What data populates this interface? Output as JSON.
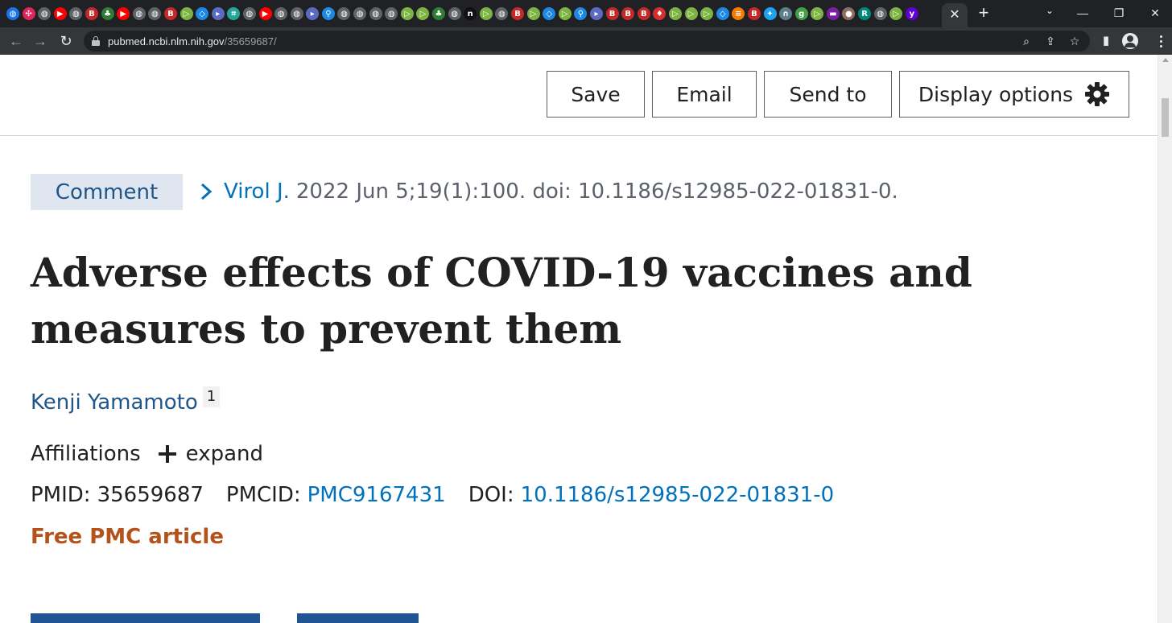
{
  "browser": {
    "active_tab_close": "✕",
    "new_tab": "+",
    "tab_search": "⌄",
    "window_controls": {
      "minimize": "—",
      "restore": "❐",
      "close": "✕"
    },
    "nav": {
      "back": "←",
      "forward": "→",
      "reload": "↻"
    },
    "url": {
      "host": "pubmed.ncbi.nlm.nih.gov",
      "path": "/35659687/"
    },
    "omnibox_icons": {
      "zoom": "⌕",
      "share": "⇪",
      "bookmark": "☆"
    },
    "side_panel_icon": "▮",
    "favicons": [
      {
        "name": "globe-icon",
        "glyph": "◍",
        "color": "#1a73e8"
      },
      {
        "name": "pin-icon",
        "glyph": "✣",
        "color": "#e0245e"
      },
      {
        "name": "globe-icon",
        "glyph": "◍",
        "color": "#5f6368"
      },
      {
        "name": "youtube-icon",
        "glyph": "▶",
        "color": "#ff0000"
      },
      {
        "name": "globe-icon",
        "glyph": "◍",
        "color": "#5f6368"
      },
      {
        "name": "bi-icon",
        "glyph": "B",
        "color": "#c62828"
      },
      {
        "name": "tree-icon",
        "glyph": "♣",
        "color": "#2e7d32"
      },
      {
        "name": "youtube-icon",
        "glyph": "▶",
        "color": "#ff0000"
      },
      {
        "name": "globe-icon",
        "glyph": "◍",
        "color": "#5f6368"
      },
      {
        "name": "globe-icon",
        "glyph": "◍",
        "color": "#5f6368"
      },
      {
        "name": "bi-icon",
        "glyph": "B",
        "color": "#c62828"
      },
      {
        "name": "play-icon",
        "glyph": "▷",
        "color": "#7cb342"
      },
      {
        "name": "shield-icon",
        "glyph": "◇",
        "color": "#1e88e5"
      },
      {
        "name": "tag-icon",
        "glyph": "▸",
        "color": "#5c6bc0"
      },
      {
        "name": "map-icon",
        "glyph": "⌗",
        "color": "#26a69a"
      },
      {
        "name": "globe-icon",
        "glyph": "◍",
        "color": "#5f6368"
      },
      {
        "name": "youtube-icon",
        "glyph": "▶",
        "color": "#ff0000"
      },
      {
        "name": "globe-icon",
        "glyph": "◍",
        "color": "#5f6368"
      },
      {
        "name": "globe-icon",
        "glyph": "◍",
        "color": "#5f6368"
      },
      {
        "name": "tag-icon",
        "glyph": "▸",
        "color": "#5c6bc0"
      },
      {
        "name": "search-icon",
        "glyph": "⚲",
        "color": "#1e88e5"
      },
      {
        "name": "globe-icon",
        "glyph": "◍",
        "color": "#5f6368"
      },
      {
        "name": "globe-icon",
        "glyph": "◍",
        "color": "#5f6368"
      },
      {
        "name": "globe-icon",
        "glyph": "◍",
        "color": "#5f6368"
      },
      {
        "name": "globe-icon",
        "glyph": "◍",
        "color": "#5f6368"
      },
      {
        "name": "play-icon",
        "glyph": "▷",
        "color": "#7cb342"
      },
      {
        "name": "play-icon",
        "glyph": "▷",
        "color": "#7cb342"
      },
      {
        "name": "tree-icon",
        "glyph": "♣",
        "color": "#2e7d32"
      },
      {
        "name": "globe-icon",
        "glyph": "◍",
        "color": "#5f6368"
      },
      {
        "name": "n-icon",
        "glyph": "n",
        "color": "#111111"
      },
      {
        "name": "play-icon",
        "glyph": "▷",
        "color": "#7cb342"
      },
      {
        "name": "globe-icon",
        "glyph": "◍",
        "color": "#5f6368"
      },
      {
        "name": "bi-icon",
        "glyph": "B",
        "color": "#c62828"
      },
      {
        "name": "play-icon",
        "glyph": "▷",
        "color": "#7cb342"
      },
      {
        "name": "shield-icon",
        "glyph": "◇",
        "color": "#1e88e5"
      },
      {
        "name": "play-icon",
        "glyph": "▷",
        "color": "#7cb342"
      },
      {
        "name": "search-icon",
        "glyph": "⚲",
        "color": "#1e88e5"
      },
      {
        "name": "tag-icon",
        "glyph": "▸",
        "color": "#5c6bc0"
      },
      {
        "name": "bi-icon",
        "glyph": "B",
        "color": "#c62828"
      },
      {
        "name": "bi-icon",
        "glyph": "B",
        "color": "#c62828"
      },
      {
        "name": "bi-icon",
        "glyph": "B",
        "color": "#c62828"
      },
      {
        "name": "mic-icon",
        "glyph": "♦",
        "color": "#d32f2f"
      },
      {
        "name": "play-icon",
        "glyph": "▷",
        "color": "#7cb342"
      },
      {
        "name": "play-icon",
        "glyph": "▷",
        "color": "#7cb342"
      },
      {
        "name": "play-icon",
        "glyph": "▷",
        "color": "#7cb342"
      },
      {
        "name": "shield-icon",
        "glyph": "◇",
        "color": "#1e88e5"
      },
      {
        "name": "stack-icon",
        "glyph": "≡",
        "color": "#f57c00"
      },
      {
        "name": "bi-icon",
        "glyph": "B",
        "color": "#c62828"
      },
      {
        "name": "twitter-icon",
        "glyph": "✦",
        "color": "#1da1f2"
      },
      {
        "name": "lock-icon",
        "glyph": "∩",
        "color": "#607d8b"
      },
      {
        "name": "g-icon",
        "glyph": "g",
        "color": "#43a047"
      },
      {
        "name": "play-icon",
        "glyph": "▷",
        "color": "#7cb342"
      },
      {
        "name": "mail-icon",
        "glyph": "▬",
        "color": "#7b1fa2"
      },
      {
        "name": "person-icon",
        "glyph": "●",
        "color": "#8d6e63"
      },
      {
        "name": "r-icon",
        "glyph": "R",
        "color": "#00897b"
      },
      {
        "name": "globe-icon",
        "glyph": "◍",
        "color": "#5f6368"
      },
      {
        "name": "play-icon",
        "glyph": "▷",
        "color": "#7cb342"
      },
      {
        "name": "yahoo-icon",
        "glyph": "y",
        "color": "#6001d2"
      }
    ]
  },
  "actions": {
    "save_label": "Save",
    "email_label": "Email",
    "send_to_label": "Send to",
    "display_options_label": "Display options"
  },
  "article": {
    "type_badge": "Comment",
    "journal": "Virol J.",
    "citation_rest": "2022 Jun 5;19(1):100. doi: 10.1186/s12985-022-01831-0.",
    "title": "Adverse effects of COVID-19 vaccines and measures to prevent them",
    "author": "Kenji Yamamoto",
    "author_sup": "1",
    "affiliations_label": "Affiliations",
    "expand_label": "expand",
    "pmid_label": "PMID:",
    "pmid": "35659687",
    "pmcid_label": "PMCID:",
    "pmcid": "PMC9167431",
    "doi_label": "DOI:",
    "doi": "10.1186/s12985-022-01831-0",
    "free_pmc": "Free PMC article"
  },
  "colors": {
    "link": "#0071bc",
    "author": "#20558a",
    "free_pmc": "#b5521a",
    "badge_bg": "#dfe6ef",
    "primary_button": "#205493"
  }
}
